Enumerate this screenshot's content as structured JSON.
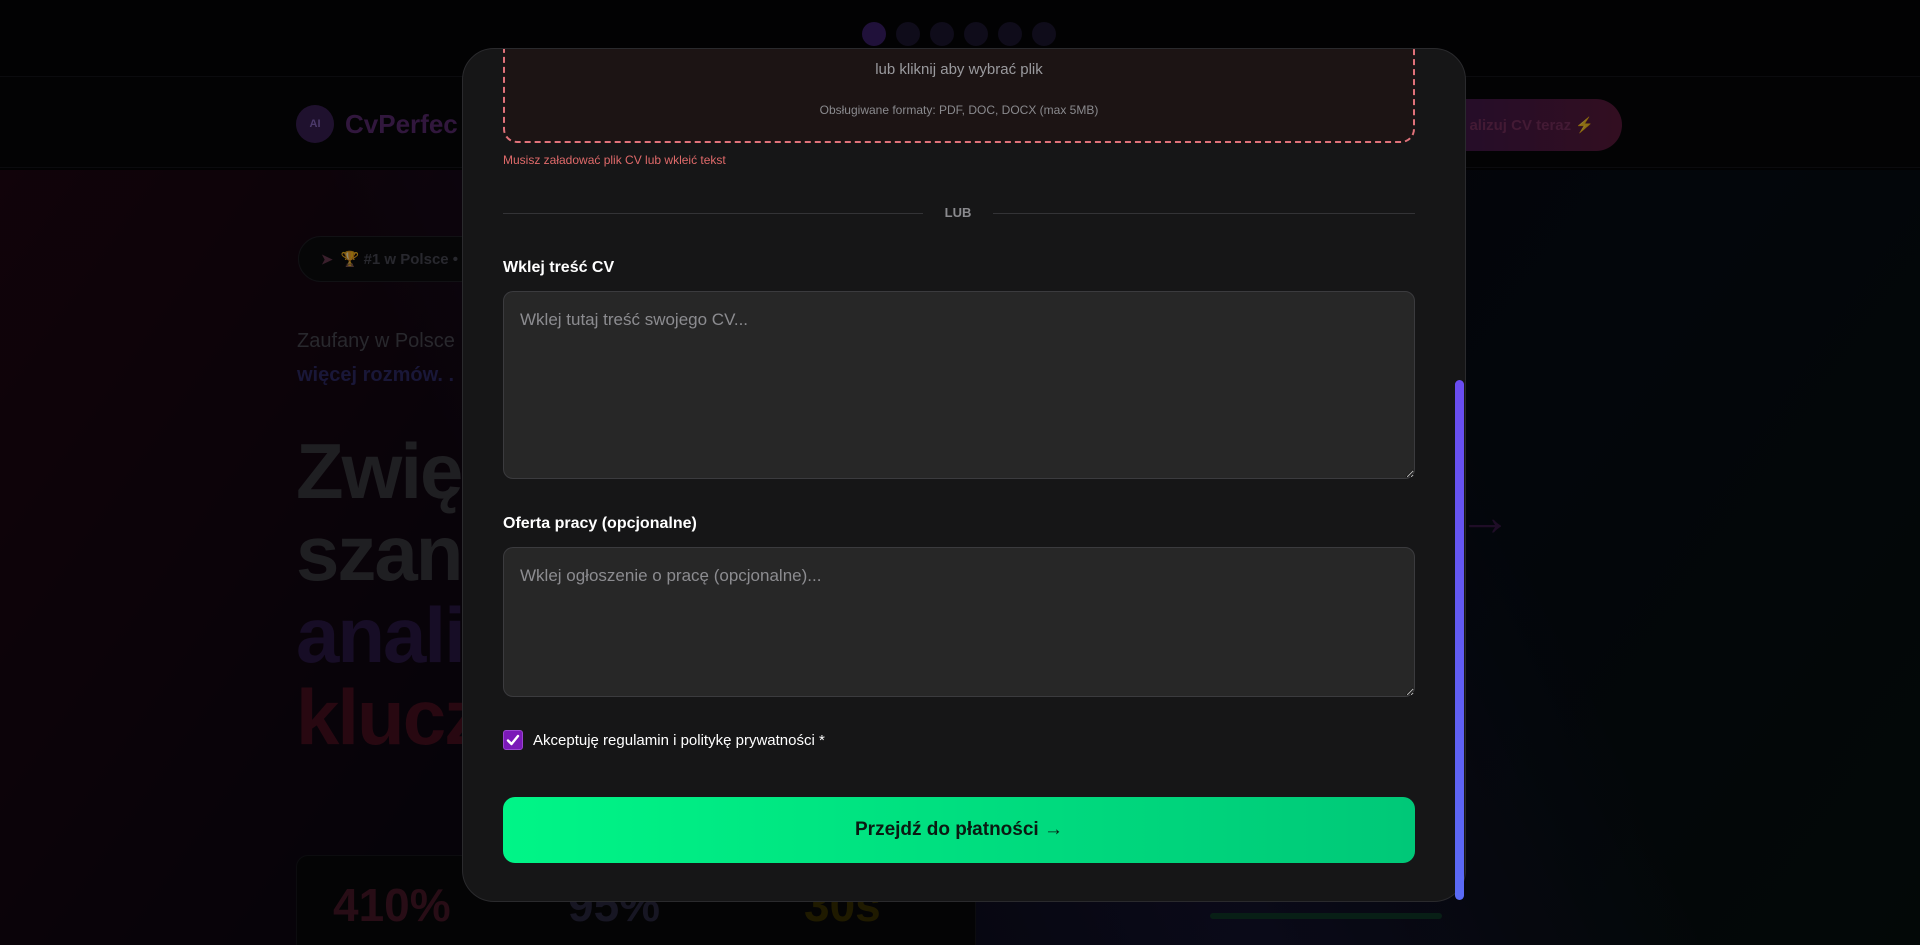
{
  "background": {
    "logo_badge": "AI",
    "logo_text": "CvPerfec",
    "cta_label": "alizuj CV teraz ⚡",
    "pill_text": "🏆 #1 w Polsce •",
    "pill_icon": "rocket-icon",
    "subtitle_line1": "Zaufany w Polsce",
    "subtitle_line2": "więcej rozmów. .",
    "hero_lines": [
      "Zwię",
      "szan",
      "anali",
      "klucz"
    ],
    "stats": [
      "410%",
      "95%",
      "30s"
    ],
    "arrow": "→"
  },
  "modal": {
    "dropzone": {
      "line1": "lub kliknij aby wybrać plik",
      "formats": "Obsługiwane formaty: PDF, DOC, DOCX (max 5MB)"
    },
    "error": "Musisz załadować plik CV lub wkleić tekst",
    "divider": "LUB",
    "cv_label": "Wklej treść CV",
    "cv_placeholder": "Wklej tutaj treść swojego CV...",
    "job_label": "Oferta pracy (opcjonalne)",
    "job_placeholder": "Wklej ogłoszenie o pracę (opcjonalne)...",
    "terms_label": "Akceptuję regulamin i politykę prywatności *",
    "terms_checked": true,
    "submit_label": "Przejdź do płatności →"
  },
  "colors": {
    "submit": "#00e67f",
    "error": "#e06a6a",
    "checkbox": "#7b19b8",
    "scrollbar": "#6a4cf0"
  }
}
